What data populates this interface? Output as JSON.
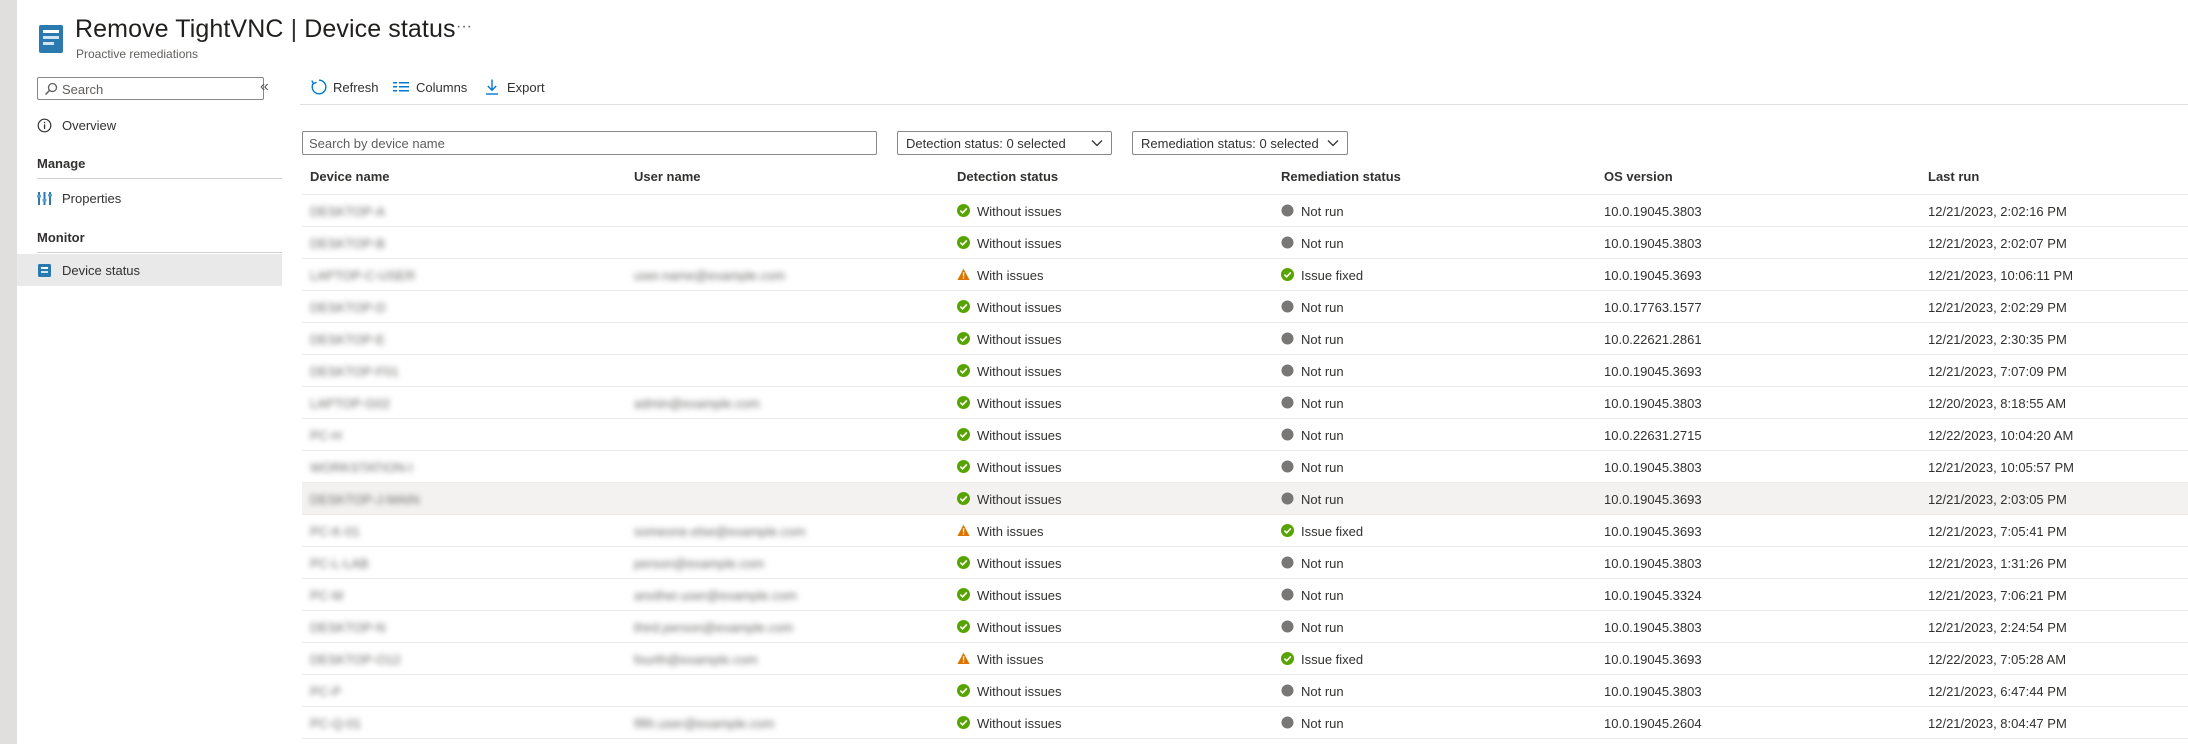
{
  "header": {
    "title_main": "Remove TightVNC",
    "title_sep": " | ",
    "title_section": "Device status",
    "subtitle": "Proactive remediations",
    "more": "···"
  },
  "sidebar": {
    "search_placeholder": "Search",
    "collapse": "«",
    "overview": "Overview",
    "manage_heading": "Manage",
    "properties": "Properties",
    "monitor_heading": "Monitor",
    "device_status": "Device status"
  },
  "toolbar": {
    "refresh": "Refresh",
    "columns": "Columns",
    "export": "Export"
  },
  "filters": {
    "device_search_placeholder": "Search by device name",
    "detection": "Detection status: 0 selected",
    "remediation": "Remediation status: 0 selected"
  },
  "table": {
    "headers": {
      "device": "Device name",
      "user": "User name",
      "detection": "Detection status",
      "remediation": "Remediation status",
      "os": "OS version",
      "last_run": "Last run"
    },
    "rows": [
      {
        "device": "DESKTOP-A",
        "user": "",
        "detection": "Without issues",
        "remediation": "Not run",
        "os": "10.0.19045.3803",
        "last_run": "12/21/2023, 2:02:16 PM"
      },
      {
        "device": "DESKTOP-B",
        "user": "",
        "detection": "Without issues",
        "remediation": "Not run",
        "os": "10.0.19045.3803",
        "last_run": "12/21/2023, 2:02:07 PM"
      },
      {
        "device": "LAPTOP-C-USER",
        "user": "user.name@example.com",
        "detection": "With issues",
        "remediation": "Issue fixed",
        "os": "10.0.19045.3693",
        "last_run": "12/21/2023, 10:06:11 PM"
      },
      {
        "device": "DESKTOP-D",
        "user": "",
        "detection": "Without issues",
        "remediation": "Not run",
        "os": "10.0.17763.1577",
        "last_run": "12/21/2023, 2:02:29 PM"
      },
      {
        "device": "DESKTOP-E",
        "user": "",
        "detection": "Without issues",
        "remediation": "Not run",
        "os": "10.0.22621.2861",
        "last_run": "12/21/2023, 2:30:35 PM"
      },
      {
        "device": "DESKTOP-F01",
        "user": "",
        "detection": "Without issues",
        "remediation": "Not run",
        "os": "10.0.19045.3693",
        "last_run": "12/21/2023, 7:07:09 PM"
      },
      {
        "device": "LAPTOP-G02",
        "user": "admin@example.com",
        "detection": "Without issues",
        "remediation": "Not run",
        "os": "10.0.19045.3803",
        "last_run": "12/20/2023, 8:18:55 AM"
      },
      {
        "device": "PC-H",
        "user": "",
        "detection": "Without issues",
        "remediation": "Not run",
        "os": "10.0.22631.2715",
        "last_run": "12/22/2023, 10:04:20 AM"
      },
      {
        "device": "WORKSTATION-I",
        "user": "",
        "detection": "Without issues",
        "remediation": "Not run",
        "os": "10.0.19045.3803",
        "last_run": "12/21/2023, 10:05:57 PM"
      },
      {
        "device": "DESKTOP-J-MAIN",
        "user": "",
        "detection": "Without issues",
        "remediation": "Not run",
        "os": "10.0.19045.3693",
        "last_run": "12/21/2023, 2:03:05 PM"
      },
      {
        "device": "PC-K-01",
        "user": "someone.else@example.com",
        "detection": "With issues",
        "remediation": "Issue fixed",
        "os": "10.0.19045.3693",
        "last_run": "12/21/2023, 7:05:41 PM"
      },
      {
        "device": "PC-L-LAB",
        "user": "person@example.com",
        "detection": "Without issues",
        "remediation": "Not run",
        "os": "10.0.19045.3803",
        "last_run": "12/21/2023, 1:31:26 PM"
      },
      {
        "device": "PC-M",
        "user": "another.user@example.com",
        "detection": "Without issues",
        "remediation": "Not run",
        "os": "10.0.19045.3324",
        "last_run": "12/21/2023, 7:06:21 PM"
      },
      {
        "device": "DESKTOP-N",
        "user": "third.person@example.com",
        "detection": "Without issues",
        "remediation": "Not run",
        "os": "10.0.19045.3803",
        "last_run": "12/21/2023, 2:24:54 PM"
      },
      {
        "device": "DESKTOP-O12",
        "user": "fourth@example.com",
        "detection": "With issues",
        "remediation": "Issue fixed",
        "os": "10.0.19045.3693",
        "last_run": "12/22/2023, 7:05:28 AM"
      },
      {
        "device": "PC-P",
        "user": "",
        "detection": "Without issues",
        "remediation": "Not run",
        "os": "10.0.19045.3803",
        "last_run": "12/21/2023, 6:47:44 PM"
      },
      {
        "device": "PC-Q-01",
        "user": "fifth.user@example.com",
        "detection": "Without issues",
        "remediation": "Not run",
        "os": "10.0.19045.2604",
        "last_run": "12/21/2023, 8:04:47 PM"
      }
    ]
  },
  "colors": {
    "success": "#57a300",
    "warning": "#db7500",
    "neutral": "#797775",
    "brand": "#2a7ab0"
  }
}
